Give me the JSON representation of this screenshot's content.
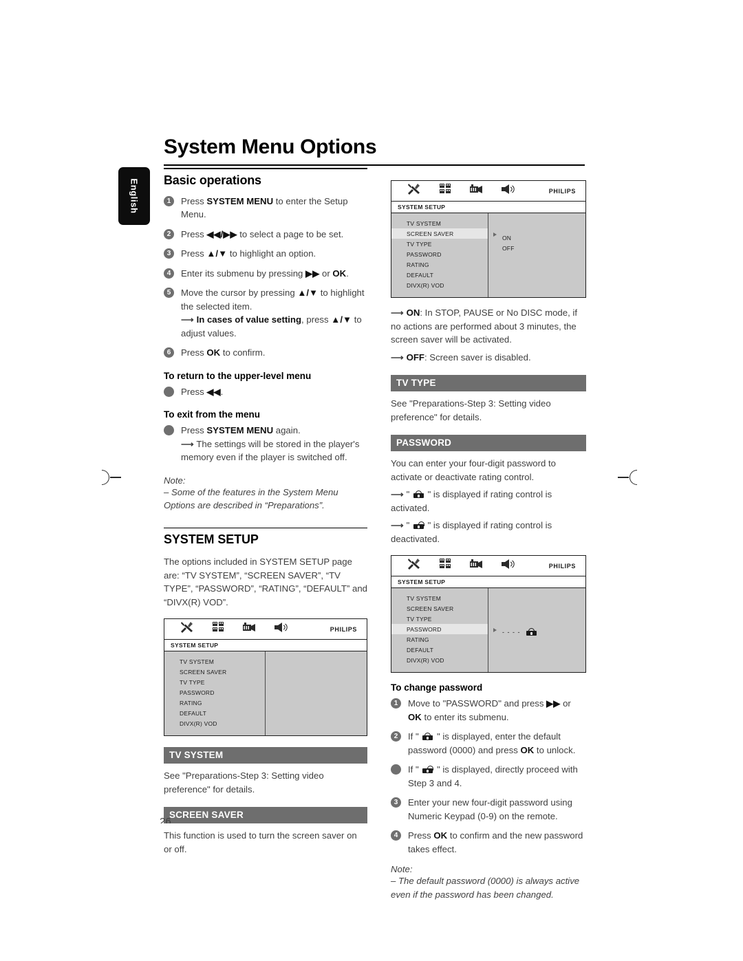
{
  "document": {
    "title": "System Menu Options",
    "language_tab": "English",
    "page_number": "26"
  },
  "left_column": {
    "basic_operations": {
      "heading": "Basic operations",
      "steps": [
        {
          "num": "1",
          "html": "Press <b>SYSTEM MENU</b> to enter the Setup Menu."
        },
        {
          "num": "2",
          "html": "Press <b>&#9664;&#9664;/&#9654;&#9654;</b> to select a page to be set."
        },
        {
          "num": "3",
          "html": "Press <b>&#9650;/&#9660;</b> to highlight an option."
        },
        {
          "num": "4",
          "html": "Enter its submenu by pressing <b>&#9654;&#9654;</b> or <b>OK</b>."
        },
        {
          "num": "5",
          "html": "Move the cursor by pressing <b>&#9650;/&#9660;</b> to highlight the selected item.<br><span class=\"arrow\">&#10230;</span> <b>In cases of value setting</b>, press <b>&#9650;/&#9660;</b> to adjust values."
        },
        {
          "num": "6",
          "html": "Press <b>OK</b> to confirm."
        }
      ],
      "upper_level_heading": "To return to the upper-level menu",
      "upper_level_item": "Press <b>&#9664;&#9664;</b>.",
      "exit_heading": "To exit from the menu",
      "exit_item": "Press <b>SYSTEM MENU</b> again.<br><span class=\"arrow\">&#10230;</span> The settings will be stored in the player's memory even if the player is switched off.",
      "note_label": "Note:",
      "note_text": "–  Some of the features in the System Menu Options are described in “Preparations”."
    },
    "system_setup": {
      "heading": "SYSTEM SETUP",
      "intro": "The options included in SYSTEM SETUP page are: “TV SYSTEM”, “SCREEN SAVER”, “TV TYPE”, “PASSWORD”, “RATING”, “DEFAULT” and “DIVX(R) VOD”."
    },
    "tv_system": {
      "band": "TV SYSTEM",
      "text": "See \"Preparations-Step 3: Setting video preference\" for details."
    },
    "screen_saver": {
      "band": "SCREEN SAVER",
      "text": "This function is used to turn the screen saver on or off."
    }
  },
  "right_column": {
    "screen_saver_detail": {
      "on_html": "<span class=\"arrow\">&#10230;</span> <b>ON</b>: In STOP, PAUSE or No DISC mode, if no actions are performed about 3 minutes, the screen saver will be activated.",
      "off_html": "<span class=\"arrow\">&#10230;</span> <b>OFF</b>: Screen saver is disabled."
    },
    "tv_type": {
      "band": "TV TYPE",
      "text": "See \"Preparations-Step 3: Setting video preference\" for details."
    },
    "password": {
      "band": "PASSWORD",
      "intro": "You can enter your four-digit password to activate or deactivate rating control.",
      "activated_html": "<span class=\"arrow\">&#10230;</span> \" <span class=\"lock\"><span class=\"shackle\"></span><span class=\"body-b\"></span><span class=\"kh\"></span></span> \" is displayed if rating control is activated.",
      "deactivated_html": "<span class=\"arrow\">&#10230;</span> \" <span class=\"lock open\"><span class=\"shackle\"></span><span class=\"body-b\"></span><span class=\"kh\"></span></span> \" is displayed if rating control is deactivated."
    },
    "change_password": {
      "heading": "To change password",
      "steps": [
        {
          "num": "1",
          "html": "Move to \"PASSWORD\" and press <b>&#9654;&#9654;</b> or <b>OK</b> to enter its submenu."
        },
        {
          "num": "2",
          "html": "If \" <span class=\"lock\"><span class=\"shackle\"></span><span class=\"body-b\"></span><span class=\"kh\"></span></span> \" is displayed, enter the default password (0000) and press <b>OK</b> to unlock."
        },
        {
          "num": "•",
          "html": "If \" <span class=\"lock open\"><span class=\"shackle\"></span><span class=\"body-b\"></span><span class=\"kh\"></span></span> \" is displayed, directly proceed with Step 3 and 4."
        },
        {
          "num": "3",
          "html": "Enter your new four-digit password using Numeric Keypad (0-9) on the remote."
        },
        {
          "num": "4",
          "html": "Press <b>OK</b> to confirm and the new password takes effect."
        }
      ],
      "note_label": "Note:",
      "note_text": "–  The default password (0000) is always active even if the password has been changed."
    }
  },
  "osd": {
    "brand": "PHILIPS",
    "title": "SYSTEM SETUP",
    "menu_items": [
      "TV SYSTEM",
      "SCREEN SAVER",
      "TV TYPE",
      "PASSWORD",
      "RATING",
      "DEFAULT",
      "DIVX(R) VOD"
    ],
    "icons": [
      "tools-icon",
      "preference-grid-icon",
      "video-icon",
      "audio-speaker-icon"
    ],
    "screenshot_system_setup": {
      "selected": null,
      "submenu": []
    },
    "screenshot_screen_saver": {
      "selected": "SCREEN SAVER",
      "submenu": [
        "ON",
        "OFF"
      ]
    },
    "screenshot_password": {
      "selected": "PASSWORD",
      "password_mask": "- - - -"
    }
  }
}
